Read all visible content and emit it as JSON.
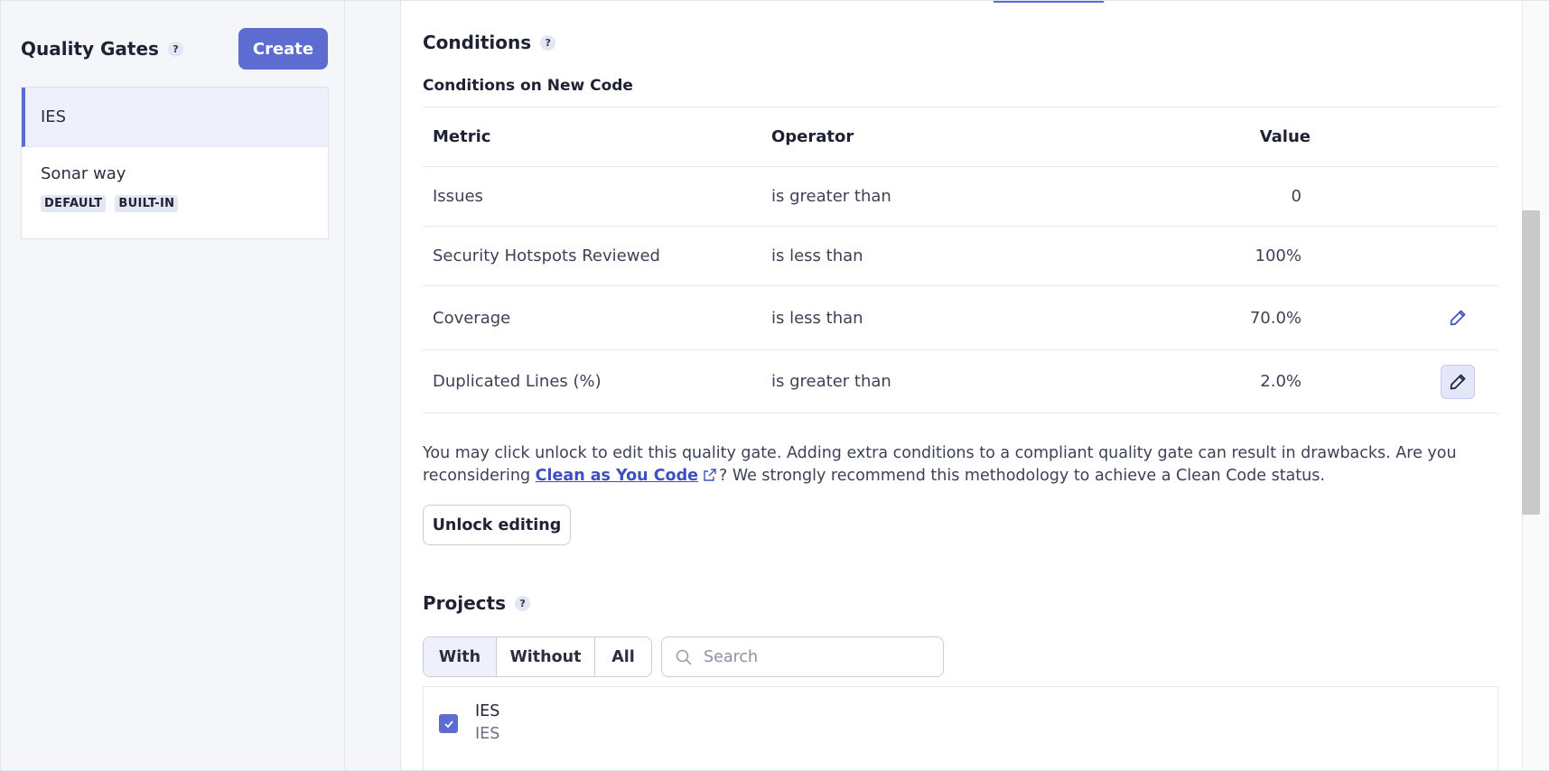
{
  "sidebar": {
    "title": "Quality Gates",
    "help": "?",
    "create_label": "Create",
    "gates": [
      {
        "name": "IES",
        "selected": true
      },
      {
        "name": "Sonar way",
        "badges": [
          "DEFAULT",
          "BUILT-IN"
        ]
      }
    ]
  },
  "conditions": {
    "title": "Conditions",
    "help": "?",
    "subtitle": "Conditions on New Code",
    "headers": {
      "metric": "Metric",
      "operator": "Operator",
      "value": "Value"
    },
    "rows": [
      {
        "metric": "Issues",
        "operator": "is greater than",
        "value": "0"
      },
      {
        "metric": "Security Hotspots Reviewed",
        "operator": "is less than",
        "value": "100%"
      },
      {
        "metric": "Coverage",
        "operator": "is less than",
        "value": "70.0%"
      },
      {
        "metric": "Duplicated Lines (%)",
        "operator": "is greater than",
        "value": "2.0%"
      }
    ]
  },
  "note": {
    "text_before": "You may click unlock to edit this quality gate. Adding extra conditions to a compliant quality gate can result in drawbacks. Are you reconsidering ",
    "link": "Clean as You Code",
    "text_after": "? We strongly recommend this methodology to achieve a Clean Code status."
  },
  "unlock_label": "Unlock editing",
  "projects": {
    "title": "Projects",
    "help": "?",
    "filters": [
      "With",
      "Without",
      "All"
    ],
    "selected_filter": "With",
    "search_placeholder": "Search",
    "items": [
      {
        "name": "IES",
        "key": "IES",
        "checked": true
      }
    ]
  },
  "colors": {
    "accent": "#5d6cd0",
    "link": "#3d4fc1",
    "text": "#2a2f40"
  },
  "icons": {
    "edit": "pencil-icon",
    "external": "external-link-icon",
    "search": "search-icon",
    "check": "checkmark-icon"
  }
}
